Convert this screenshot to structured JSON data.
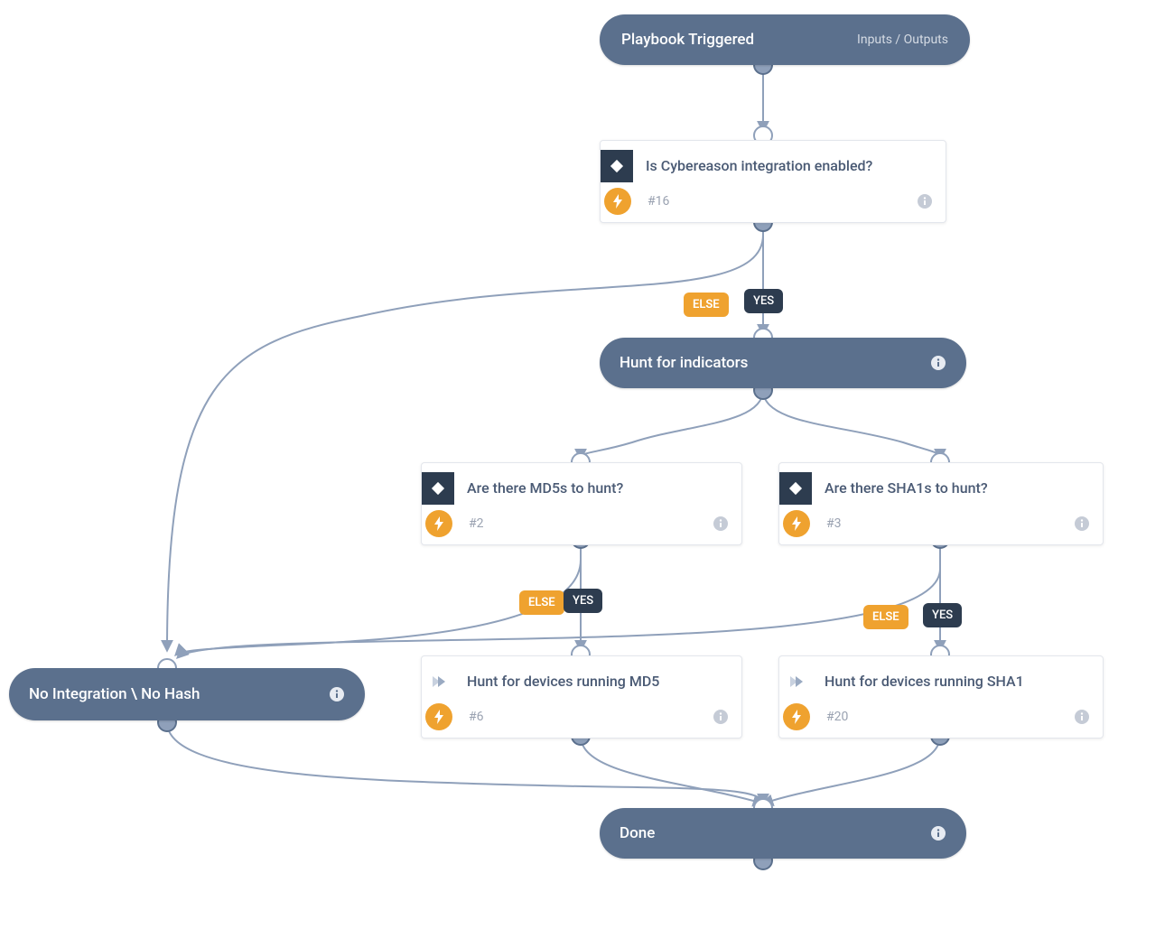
{
  "start": {
    "title": "Playbook Triggered",
    "io_label": "Inputs / Outputs"
  },
  "nodes": {
    "cyb": {
      "question": "Is Cybereason integration enabled?",
      "hash": "#16"
    },
    "hunt": {
      "title": "Hunt for indicators"
    },
    "md5q": {
      "question": "Are there MD5s to hunt?",
      "hash": "#2"
    },
    "sha1q": {
      "question": "Are there SHA1s to hunt?",
      "hash": "#3"
    },
    "md5r": {
      "question": "Hunt for devices running MD5",
      "hash": "#6"
    },
    "sha1r": {
      "question": "Hunt for devices running SHA1",
      "hash": "#20"
    },
    "nohash": {
      "title": "No Integration \\ No Hash"
    },
    "done": {
      "title": "Done"
    }
  },
  "branches": {
    "else": "ELSE",
    "yes": "YES"
  },
  "colors": {
    "pill": "#5b708d",
    "accent": "#efa22f",
    "dark": "#2d3c4f",
    "edge": "#8fa0ba"
  }
}
